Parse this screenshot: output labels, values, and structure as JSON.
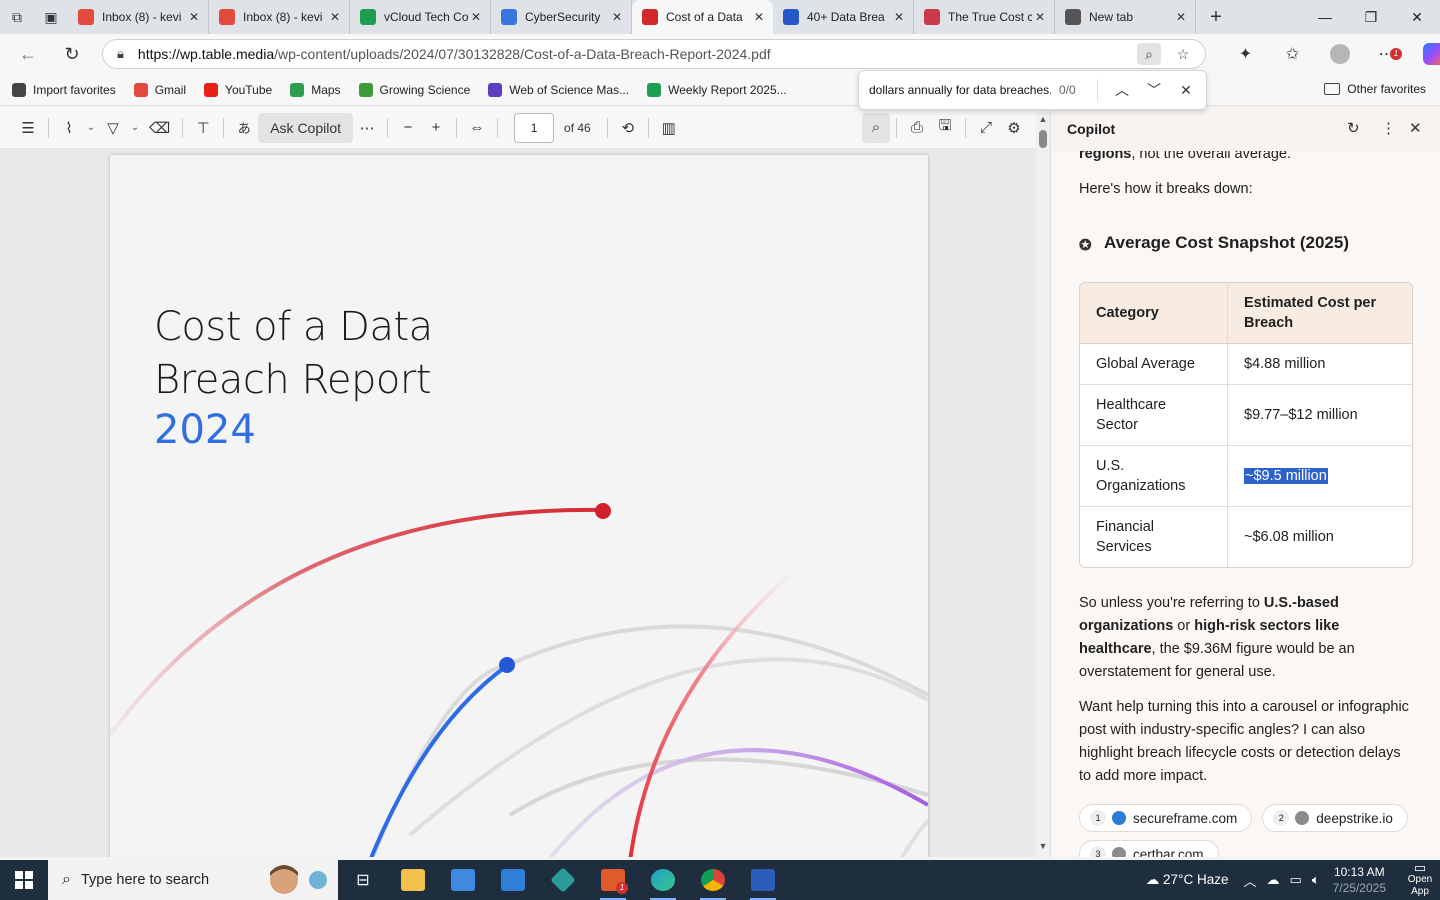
{
  "tabs": [
    {
      "title": "Inbox (8) - kevi",
      "icon": "gmail-icon",
      "color": "#e04b3c"
    },
    {
      "title": "Inbox (8) - kevi",
      "icon": "gmail-icon",
      "color": "#e04b3c"
    },
    {
      "title": "vCloud Tech Co",
      "icon": "sheets-icon",
      "color": "#1e9e50"
    },
    {
      "title": "CyberSecurity",
      "icon": "docs-icon",
      "color": "#3b76e0"
    },
    {
      "title": "Cost of a Data",
      "icon": "pdf-icon",
      "color": "#d02a2a"
    },
    {
      "title": "40+ Data Brea",
      "icon": "shield-icon",
      "color": "#2657c9"
    },
    {
      "title": "The True Cost c",
      "icon": "shield-icon",
      "color": "#c93a4a"
    },
    {
      "title": "New tab",
      "icon": "newtab-icon",
      "color": "#555555"
    }
  ],
  "address": {
    "url_host": "https://wp.table.media",
    "url_path": "/wp-content/uploads/2024/07/30132828/Cost-of-a-Data-Breach-Report-2024.pdf"
  },
  "favorites": [
    {
      "label": "Import favorites",
      "icon": "import-icon",
      "color": "#444444"
    },
    {
      "label": "Gmail",
      "icon": "gmail-icon",
      "color": "#e04b3c"
    },
    {
      "label": "YouTube",
      "icon": "youtube-icon",
      "color": "#e62117"
    },
    {
      "label": "Maps",
      "icon": "maps-icon",
      "color": "#2e9e4f"
    },
    {
      "label": "Growing Science",
      "icon": "growing-science-icon",
      "color": "#3a9b3a"
    },
    {
      "label": "Web of Science Mas...",
      "icon": "wos-icon",
      "color": "#5b3fbf"
    },
    {
      "label": "Weekly Report 2025...",
      "icon": "sheets-icon",
      "color": "#1e9e50"
    }
  ],
  "other_favorites": "Other favorites",
  "find": {
    "query": "dollars annually for data breaches.",
    "count": "0/0"
  },
  "pdf_toolbar": {
    "ask_copilot": "Ask Copilot",
    "page": "1",
    "page_total": "of 46"
  },
  "pdf_page": {
    "title_line1": "Cost of a Data",
    "title_line2": "Breach Report",
    "year": "2024"
  },
  "copilot": {
    "header": "Copilot",
    "top_fragment_bold": "regions",
    "top_fragment_rest": ", not the overall average.",
    "intro": "Here's how it breaks down:",
    "heading": "Average Cost Snapshot (2025)",
    "table_headers": [
      "Category",
      "Estimated Cost per Breach"
    ],
    "table_rows": [
      [
        "Global Average",
        "$4.88 million"
      ],
      [
        "Healthcare Sector",
        "$9.77–$12 million"
      ],
      [
        "U.S. Organizations",
        "~$9.5 million"
      ],
      [
        "Financial Services",
        "~$6.08 million"
      ]
    ],
    "para1": {
      "a": "So unless you're referring to ",
      "b": "U.S.-based organizations",
      "c": " or ",
      "d": "high-risk sectors like healthcare",
      "e": ", the $9.36M figure would be an overstatement for general use."
    },
    "para2": "Want help turning this into a carousel or infographic post with industry-specific angles? I can also highlight breach lifecycle costs or detection delays to add more impact.",
    "citations": [
      {
        "n": "1",
        "label": "secureframe.com"
      },
      {
        "n": "2",
        "label": "deepstrike.io"
      },
      {
        "n": "3",
        "label": "certbar.com"
      }
    ]
  },
  "taskbar": {
    "search_placeholder": "Type here to search",
    "weather": "27°C  Haze",
    "weather_badge": "2",
    "time": "10:13 AM",
    "date": "7/25/2025",
    "open_app": "Open App",
    "zoom_badge": "1"
  }
}
